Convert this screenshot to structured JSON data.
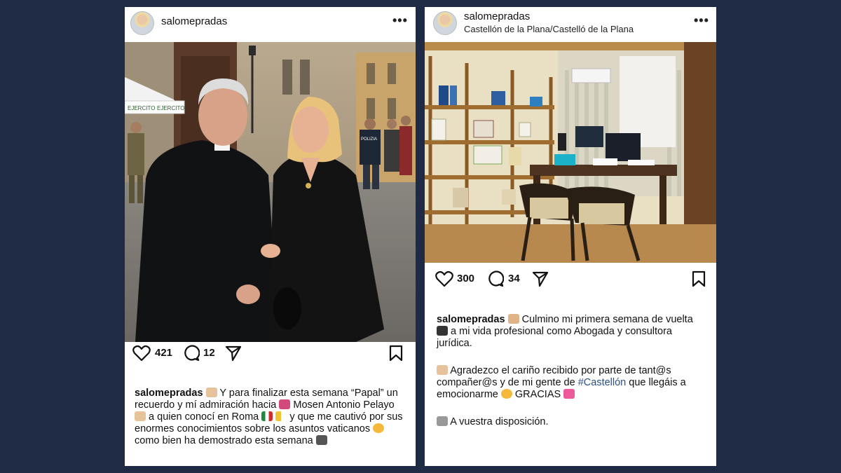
{
  "posts": [
    {
      "username": "salomepradas",
      "more_icon": "more-horizontal-icon",
      "likes": "421",
      "comments": "12",
      "caption": {
        "user": "salomepradas",
        "parts": [
          "Y para finalizar esta semana “Papal” un recuerdo y mí admiración hacia",
          "Mosen Antonio Pelayo",
          "a quien conocí en Roma",
          "y que  me cautivó por sus enormes conocimientos sobre los asuntos vaticanos",
          "como bien ha demostrado esta semana"
        ]
      },
      "photo_signs": {
        "tent_sign": "EJERCITO",
        "tent_sign2": "EJERCITO",
        "police": "POLIZIA"
      }
    },
    {
      "username": "salomepradas",
      "location": "Castellón de la Plana/Castelló de la Plana",
      "more_icon": "more-horizontal-icon",
      "likes": "300",
      "comments": "34",
      "caption": {
        "user": "salomepradas",
        "line1": "Culmino mi primera semana de vuelta",
        "line1b": "a mi vida profesional como Abogada y consultora jurídica.",
        "para2a": "Agradezco el cariño recibido por parte de tant@s compañer@s y de mi gente de",
        "hashtag": "#Castellón",
        "para2b": "que llegáis a emocionarme",
        "para2c": "GRACIAS",
        "para3": "A vuestra disposición."
      }
    }
  ],
  "colors": {
    "background": "#1f2a44",
    "card": "#ffffff",
    "hashtag": "#2c4f80"
  }
}
